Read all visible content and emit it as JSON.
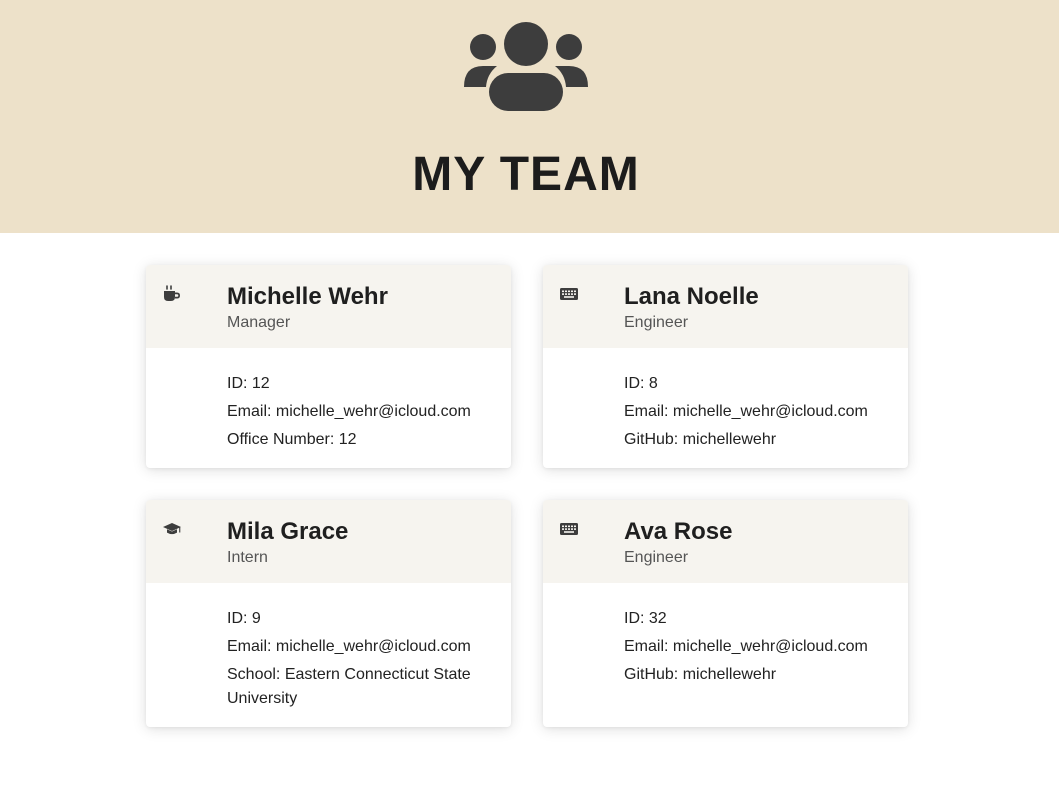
{
  "header": {
    "title": "MY TEAM",
    "icon": "users-icon"
  },
  "colors": {
    "hero_bg": "#ede1c9",
    "card_head_bg": "#f6f4ef",
    "icon": "#3d3d3d"
  },
  "cards": [
    {
      "name": "Michelle Wehr",
      "role": "Manager",
      "icon": "coffee-icon",
      "id": "ID: 12",
      "email": "Email: michelle_wehr@icloud.com",
      "extra": "Office Number: 12"
    },
    {
      "name": "Lana Noelle",
      "role": "Engineer",
      "icon": "keyboard-icon",
      "id": "ID: 8",
      "email": "Email: michelle_wehr@icloud.com",
      "extra": "GitHub: michellewehr"
    },
    {
      "name": "Mila Grace",
      "role": "Intern",
      "icon": "graduation-cap-icon",
      "id": "ID: 9",
      "email": "Email: michelle_wehr@icloud.com",
      "extra": "School: Eastern Connecticut State University"
    },
    {
      "name": "Ava Rose",
      "role": "Engineer",
      "icon": "keyboard-icon",
      "id": "ID: 32",
      "email": "Email: michelle_wehr@icloud.com",
      "extra": "GitHub: michellewehr"
    }
  ]
}
